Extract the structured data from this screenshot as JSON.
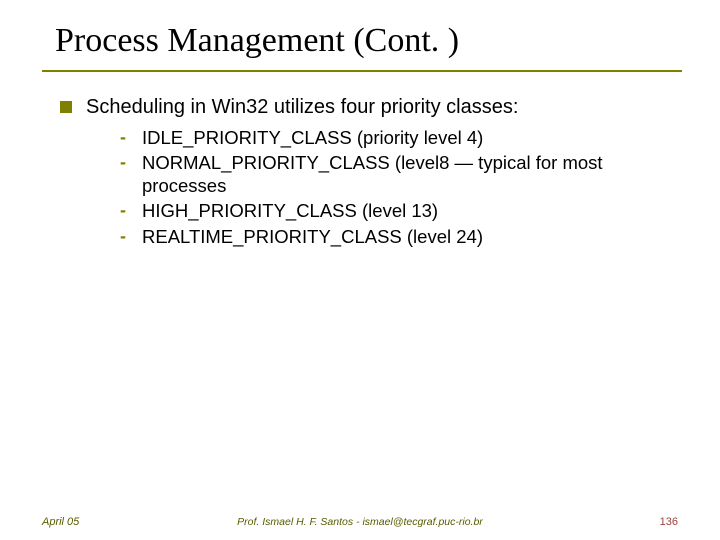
{
  "title": "Process Management (Cont. )",
  "bullet1": "Scheduling in Win32 utilizes four priority classes:",
  "sub": [
    "IDLE_PRIORITY_CLASS (priority level 4)",
    "NORMAL_PRIORITY_CLASS (level8 — typical for most processes",
    "HIGH_PRIORITY_CLASS (level 13)",
    "REALTIME_PRIORITY_CLASS (level 24)"
  ],
  "footer": {
    "left": "April 05",
    "center": "Prof. Ismael H. F. Santos  -  ismael@tecgraf.puc-rio.br",
    "right": "136"
  }
}
